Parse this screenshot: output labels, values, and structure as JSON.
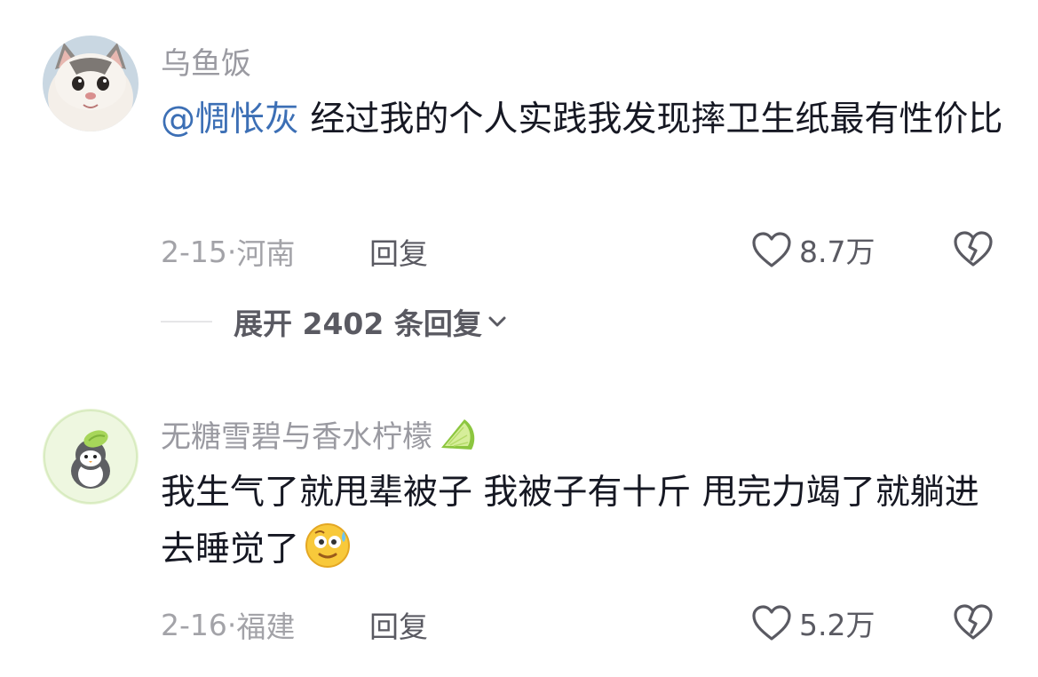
{
  "comments": [
    {
      "username": "乌鱼饭",
      "mention": "@惆怅灰",
      "text": " 经过我的个人实践我发现摔卫生纸最有性价比",
      "date": "2-15",
      "location": "河南",
      "reply_label": "回复",
      "likes": "8.7万",
      "expand_label": "展开 2402 条回复"
    },
    {
      "username": "无糖雪碧与香水柠檬",
      "username_emoji": "lime-icon",
      "text": "我生气了就甩辈被子 我被子有十斤 甩完力竭了就躺进去睡觉了",
      "text_emoji": "sweat-smile-emoji",
      "date": "2-16",
      "location": "福建",
      "reply_label": "回复",
      "likes": "5.2万"
    }
  ],
  "colors": {
    "mention": "#3c6fb5",
    "text": "#161823",
    "secondary": "#9a9aa1",
    "action": "#5a5a62"
  }
}
